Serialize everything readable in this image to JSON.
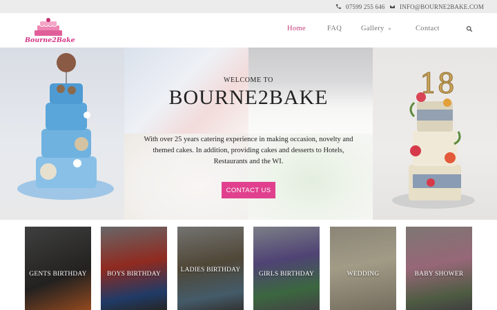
{
  "topbar": {
    "phone": "07599 255 646",
    "email": "INFO@BOURNE2BAKE.COM"
  },
  "logo": {
    "text": "Bourne2Bake"
  },
  "nav": {
    "home": "Home",
    "faq": "FAQ",
    "gallery": "Gallery",
    "contact": "Contact"
  },
  "hero": {
    "welcome": "Welcome to",
    "title": "BOURNE2BAKE",
    "description": "With over 25 years catering experience in making occasion, novelty and themed cakes. In addition, providing cakes and desserts to Hotels, Restaurants and the WI.",
    "cta": "CONTACT US",
    "right_cake_number": "18"
  },
  "categories": [
    {
      "label": "Gents Birthday",
      "bg": "#3a3836"
    },
    {
      "label": "Boys Birthday",
      "bg": "#5b4b47"
    },
    {
      "label": "Ladies Birthday",
      "bg": "#6e6a63"
    },
    {
      "label": "Girls Birthday",
      "bg": "#7b8293"
    },
    {
      "label": "Wedding",
      "bg": "#a59d86"
    },
    {
      "label": "Baby Shower",
      "bg": "#7c6e68"
    }
  ],
  "colors": {
    "accent": "#e0408e",
    "nav_active": "#c23b7c"
  }
}
